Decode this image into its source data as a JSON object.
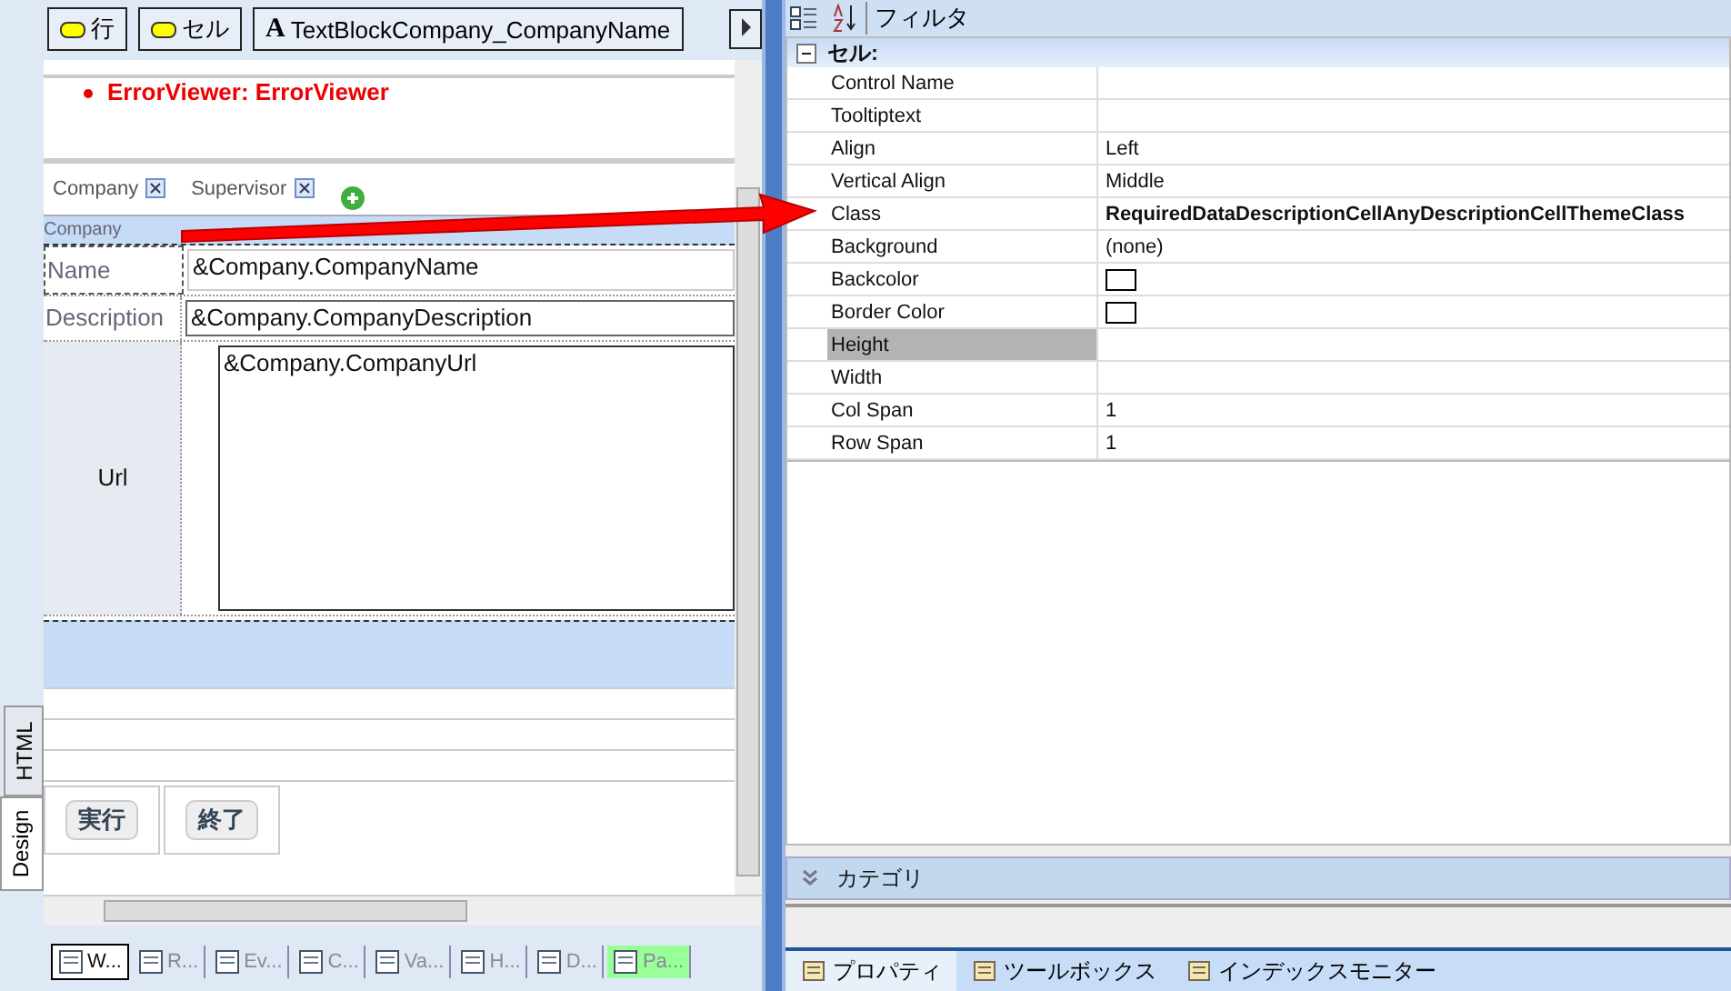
{
  "designer": {
    "toolbar": [
      {
        "label": "行",
        "kind": "row"
      },
      {
        "label": "セル",
        "kind": "cell"
      },
      {
        "label": "TextBlockCompany_CompanyName",
        "kind": "textblock",
        "icon_text": "A"
      }
    ],
    "error_text": "ErrorViewer: ErrorViewer",
    "tabs": [
      "Company",
      "Supervisor"
    ],
    "section_label": "Company",
    "rows": [
      {
        "label": "Name",
        "value": "&Company.CompanyName",
        "selected": true
      },
      {
        "label": "Description",
        "value": "&Company.CompanyDescription",
        "selected": false
      },
      {
        "label": "Url",
        "value": "&Company.CompanyUrl",
        "selected": false
      }
    ],
    "buttons": [
      "実行",
      "終了"
    ],
    "view_tabs": [
      {
        "label": "HTML",
        "selected": false
      },
      {
        "label": "Design",
        "selected": true
      }
    ]
  },
  "bottom_tabs": [
    {
      "label": "W...",
      "selected": true,
      "highlighted": false
    },
    {
      "label": "R...",
      "selected": false,
      "highlighted": false
    },
    {
      "label": "Ev...",
      "selected": false,
      "highlighted": false
    },
    {
      "label": "C...",
      "selected": false,
      "highlighted": false
    },
    {
      "label": "Va...",
      "selected": false,
      "highlighted": false
    },
    {
      "label": "H...",
      "selected": false,
      "highlighted": false
    },
    {
      "label": "D...",
      "selected": false,
      "highlighted": false
    },
    {
      "label": "Pa...",
      "selected": false,
      "highlighted": true
    }
  ],
  "properties": {
    "filter_label": "フィルタ",
    "category": "セル:",
    "expanded": true,
    "items": [
      {
        "name": "Control Name",
        "kind": "text",
        "selected": false
      },
      {
        "name": "Tooltiptext",
        "kind": "text",
        "selected": false
      },
      {
        "name": "Align",
        "value": "Left",
        "kind": "text",
        "selected": false
      },
      {
        "name": "Vertical Align",
        "value": "Middle",
        "kind": "text",
        "selected": false
      },
      {
        "name": "Class",
        "value": "RequiredDataDescriptionCellAnyDescriptionCellThemeClass",
        "kind": "bold",
        "selected": false
      },
      {
        "name": "Background",
        "value": "(none)",
        "kind": "text",
        "selected": false
      },
      {
        "name": "Backcolor",
        "kind": "swatch",
        "selected": false
      },
      {
        "name": "Border Color",
        "kind": "swatch",
        "selected": false
      },
      {
        "name": "Height",
        "kind": "text",
        "selected": true
      },
      {
        "name": "Width",
        "kind": "text",
        "selected": false
      },
      {
        "name": "Col Span",
        "value": "1",
        "kind": "text",
        "selected": false
      },
      {
        "name": "Row Span",
        "value": "1",
        "kind": "text",
        "selected": false
      }
    ],
    "category_bar": "カテゴリ"
  },
  "panel_tabs": [
    {
      "label": "プロパティ",
      "selected": true
    },
    {
      "label": "ツールボックス",
      "selected": false
    },
    {
      "label": "インデックスモニター",
      "selected": false
    }
  ]
}
